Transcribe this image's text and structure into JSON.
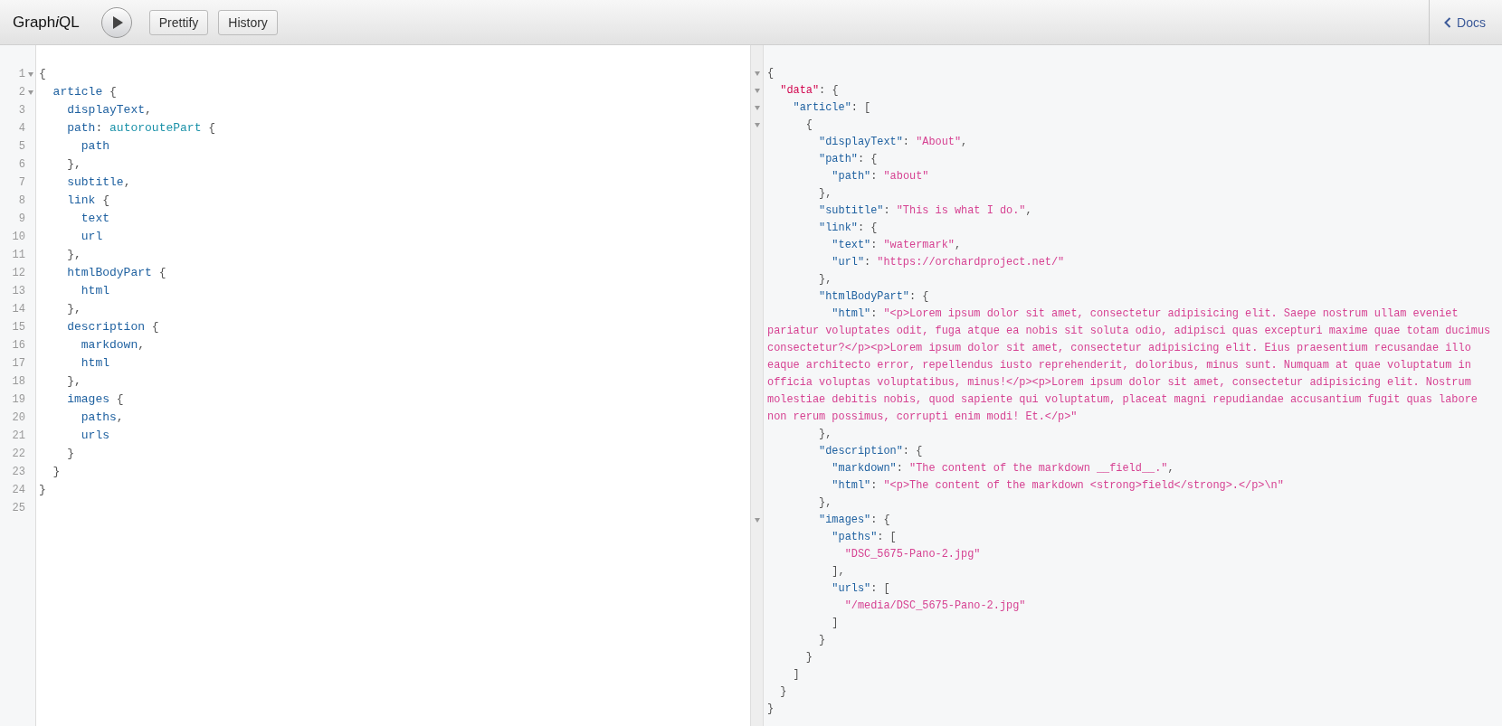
{
  "toolbar": {
    "title": [
      {
        "text": "Graph",
        "italic": false
      },
      {
        "text": "i",
        "italic": true
      },
      {
        "text": "QL",
        "italic": false
      }
    ],
    "buttons": [
      "Prettify",
      "History"
    ],
    "docs": "Docs"
  },
  "query": {
    "lines": [
      {
        "number": "1",
        "foldable": true,
        "tokens": [
          {
            "kind": "punct",
            "text": "{"
          }
        ]
      },
      {
        "number": "2",
        "foldable": true,
        "tokens": [
          {
            "kind": "field",
            "text": "  article"
          },
          {
            "kind": "punct",
            "text": " {"
          }
        ]
      },
      {
        "number": "3",
        "foldable": false,
        "tokens": [
          {
            "kind": "field",
            "text": "    displayText"
          },
          {
            "kind": "punct",
            "text": ","
          }
        ]
      },
      {
        "number": "4",
        "foldable": false,
        "tokens": [
          {
            "kind": "field",
            "text": "    path"
          },
          {
            "kind": "punct",
            "text": ": "
          },
          {
            "kind": "alias",
            "text": "autoroutePart"
          },
          {
            "kind": "punct",
            "text": " {"
          }
        ]
      },
      {
        "number": "5",
        "foldable": false,
        "tokens": [
          {
            "kind": "field",
            "text": "      path"
          }
        ]
      },
      {
        "number": "6",
        "foldable": false,
        "tokens": [
          {
            "kind": "punct",
            "text": "    },"
          }
        ]
      },
      {
        "number": "7",
        "foldable": false,
        "tokens": [
          {
            "kind": "field",
            "text": "    subtitle"
          },
          {
            "kind": "punct",
            "text": ","
          }
        ]
      },
      {
        "number": "8",
        "foldable": false,
        "tokens": [
          {
            "kind": "field",
            "text": "    link"
          },
          {
            "kind": "punct",
            "text": " {"
          }
        ]
      },
      {
        "number": "9",
        "foldable": false,
        "tokens": [
          {
            "kind": "field",
            "text": "      text"
          }
        ]
      },
      {
        "number": "10",
        "foldable": false,
        "tokens": [
          {
            "kind": "field",
            "text": "      url"
          }
        ]
      },
      {
        "number": "11",
        "foldable": false,
        "tokens": [
          {
            "kind": "punct",
            "text": "    },"
          }
        ]
      },
      {
        "number": "12",
        "foldable": false,
        "tokens": [
          {
            "kind": "field",
            "text": "    htmlBodyPart"
          },
          {
            "kind": "punct",
            "text": " {"
          }
        ]
      },
      {
        "number": "13",
        "foldable": false,
        "tokens": [
          {
            "kind": "field",
            "text": "      html"
          }
        ]
      },
      {
        "number": "14",
        "foldable": false,
        "tokens": [
          {
            "kind": "punct",
            "text": "    },"
          }
        ]
      },
      {
        "number": "15",
        "foldable": false,
        "tokens": [
          {
            "kind": "field",
            "text": "    description"
          },
          {
            "kind": "punct",
            "text": " {"
          }
        ]
      },
      {
        "number": "16",
        "foldable": false,
        "tokens": [
          {
            "kind": "field",
            "text": "      markdown"
          },
          {
            "kind": "punct",
            "text": ","
          }
        ]
      },
      {
        "number": "17",
        "foldable": false,
        "tokens": [
          {
            "kind": "field",
            "text": "      html"
          }
        ]
      },
      {
        "number": "18",
        "foldable": false,
        "tokens": [
          {
            "kind": "punct",
            "text": "    },"
          }
        ]
      },
      {
        "number": "19",
        "foldable": false,
        "tokens": [
          {
            "kind": "field",
            "text": "    images"
          },
          {
            "kind": "punct",
            "text": " {"
          }
        ]
      },
      {
        "number": "20",
        "foldable": false,
        "tokens": [
          {
            "kind": "field",
            "text": "      paths"
          },
          {
            "kind": "punct",
            "text": ","
          }
        ]
      },
      {
        "number": "21",
        "foldable": false,
        "tokens": [
          {
            "kind": "field",
            "text": "      urls"
          }
        ]
      },
      {
        "number": "22",
        "foldable": false,
        "tokens": [
          {
            "kind": "punct",
            "text": "    }"
          }
        ]
      },
      {
        "number": "23",
        "foldable": false,
        "tokens": [
          {
            "kind": "punct",
            "text": "  }"
          }
        ]
      },
      {
        "number": "24",
        "foldable": false,
        "tokens": [
          {
            "kind": "punct",
            "text": "}"
          }
        ]
      },
      {
        "number": "25",
        "foldable": false
      }
    ]
  },
  "result": {
    "lines": [
      {
        "foldable": true,
        "tokens": [
          {
            "kind": "punct",
            "text": "{"
          }
        ]
      },
      {
        "foldable": true,
        "tokens": [
          {
            "kind": "rootkey",
            "text": "  \"data\""
          },
          {
            "kind": "punct",
            "text": ": {"
          }
        ]
      },
      {
        "foldable": true,
        "tokens": [
          {
            "kind": "key",
            "text": "    \"article\""
          },
          {
            "kind": "punct",
            "text": ": ["
          }
        ]
      },
      {
        "foldable": true,
        "tokens": [
          {
            "kind": "punct",
            "text": "      {"
          }
        ]
      },
      {
        "foldable": false,
        "tokens": [
          {
            "kind": "key",
            "text": "        \"displayText\""
          },
          {
            "kind": "punct",
            "text": ": "
          },
          {
            "kind": "string",
            "text": "\"About\""
          },
          {
            "kind": "punct",
            "text": ","
          }
        ]
      },
      {
        "foldable": false,
        "tokens": [
          {
            "kind": "key",
            "text": "        \"path\""
          },
          {
            "kind": "punct",
            "text": ": {"
          }
        ]
      },
      {
        "foldable": false,
        "tokens": [
          {
            "kind": "key",
            "text": "          \"path\""
          },
          {
            "kind": "punct",
            "text": ": "
          },
          {
            "kind": "string",
            "text": "\"about\""
          }
        ]
      },
      {
        "foldable": false,
        "tokens": [
          {
            "kind": "punct",
            "text": "        },"
          }
        ]
      },
      {
        "foldable": false,
        "tokens": [
          {
            "kind": "key",
            "text": "        \"subtitle\""
          },
          {
            "kind": "punct",
            "text": ": "
          },
          {
            "kind": "string",
            "text": "\"This is what I do.\""
          },
          {
            "kind": "punct",
            "text": ","
          }
        ]
      },
      {
        "foldable": false,
        "tokens": [
          {
            "kind": "key",
            "text": "        \"link\""
          },
          {
            "kind": "punct",
            "text": ": {"
          }
        ]
      },
      {
        "foldable": false,
        "tokens": [
          {
            "kind": "key",
            "text": "          \"text\""
          },
          {
            "kind": "punct",
            "text": ": "
          },
          {
            "kind": "string",
            "text": "\"watermark\""
          },
          {
            "kind": "punct",
            "text": ","
          }
        ]
      },
      {
        "foldable": false,
        "tokens": [
          {
            "kind": "key",
            "text": "          \"url\""
          },
          {
            "kind": "punct",
            "text": ": "
          },
          {
            "kind": "string",
            "text": "\"https://orchardproject.net/\""
          }
        ]
      },
      {
        "foldable": false,
        "tokens": [
          {
            "kind": "punct",
            "text": "        },"
          }
        ]
      },
      {
        "foldable": false,
        "tokens": [
          {
            "kind": "key",
            "text": "        \"htmlBodyPart\""
          },
          {
            "kind": "punct",
            "text": ": {"
          }
        ]
      },
      {
        "foldable": false,
        "tokens": [
          {
            "kind": "key",
            "text": "          \"html\""
          },
          {
            "kind": "punct",
            "text": ": "
          },
          {
            "kind": "string",
            "text": "\"<p>Lorem ipsum dolor sit amet, consectetur adipisicing elit. Saepe nostrum ullam eveniet pariatur voluptates odit, fuga atque ea nobis sit soluta odio, adipisci quas excepturi maxime quae totam ducimus consectetur?</p><p>Lorem ipsum dolor sit amet, consectetur adipisicing elit. Eius praesentium recusandae illo eaque architecto error, repellendus iusto reprehenderit, doloribus, minus sunt. Numquam at quae voluptatum in officia voluptas voluptatibus, minus!</p><p>Lorem ipsum dolor sit amet, consectetur adipisicing elit. Nostrum molestiae debitis nobis, quod sapiente qui voluptatum, placeat magni repudiandae accusantium fugit quas labore non rerum possimus, corrupti enim modi! Et.</p>\""
          }
        ]
      },
      {
        "foldable": false,
        "tokens": [
          {
            "kind": "punct",
            "text": "        },"
          }
        ]
      },
      {
        "foldable": false,
        "tokens": [
          {
            "kind": "key",
            "text": "        \"description\""
          },
          {
            "kind": "punct",
            "text": ": {"
          }
        ]
      },
      {
        "foldable": false,
        "tokens": [
          {
            "kind": "key",
            "text": "          \"markdown\""
          },
          {
            "kind": "punct",
            "text": ": "
          },
          {
            "kind": "string",
            "text": "\"The content of the markdown __field__.\""
          },
          {
            "kind": "punct",
            "text": ","
          }
        ]
      },
      {
        "foldable": false,
        "tokens": [
          {
            "kind": "key",
            "text": "          \"html\""
          },
          {
            "kind": "punct",
            "text": ": "
          },
          {
            "kind": "string",
            "text": "\"<p>The content of the markdown <strong>field</strong>.</p>\\n\""
          }
        ]
      },
      {
        "foldable": false,
        "tokens": [
          {
            "kind": "punct",
            "text": "        },"
          }
        ]
      },
      {
        "foldable": true,
        "tokens": [
          {
            "kind": "key",
            "text": "        \"images\""
          },
          {
            "kind": "punct",
            "text": ": {"
          }
        ]
      },
      {
        "foldable": false,
        "tokens": [
          {
            "kind": "key",
            "text": "          \"paths\""
          },
          {
            "kind": "punct",
            "text": ": ["
          }
        ]
      },
      {
        "foldable": false,
        "tokens": [
          {
            "kind": "string",
            "text": "            \"DSC_5675-Pano-2.jpg\""
          }
        ]
      },
      {
        "foldable": false,
        "tokens": [
          {
            "kind": "punct",
            "text": "          ],"
          }
        ]
      },
      {
        "foldable": false,
        "tokens": [
          {
            "kind": "key",
            "text": "          \"urls\""
          },
          {
            "kind": "punct",
            "text": ": ["
          }
        ]
      },
      {
        "foldable": false,
        "tokens": [
          {
            "kind": "string",
            "text": "            \"/media/DSC_5675-Pano-2.jpg\""
          }
        ]
      },
      {
        "foldable": false,
        "tokens": [
          {
            "kind": "punct",
            "text": "          ]"
          }
        ]
      },
      {
        "foldable": false,
        "tokens": [
          {
            "kind": "punct",
            "text": "        }"
          }
        ]
      },
      {
        "foldable": false,
        "tokens": [
          {
            "kind": "punct",
            "text": "      }"
          }
        ]
      },
      {
        "foldable": false,
        "tokens": [
          {
            "kind": "punct",
            "text": "    ]"
          }
        ]
      },
      {
        "foldable": false,
        "tokens": [
          {
            "kind": "punct",
            "text": "  }"
          }
        ]
      },
      {
        "foldable": false,
        "tokens": [
          {
            "kind": "punct",
            "text": "}"
          }
        ]
      }
    ]
  }
}
